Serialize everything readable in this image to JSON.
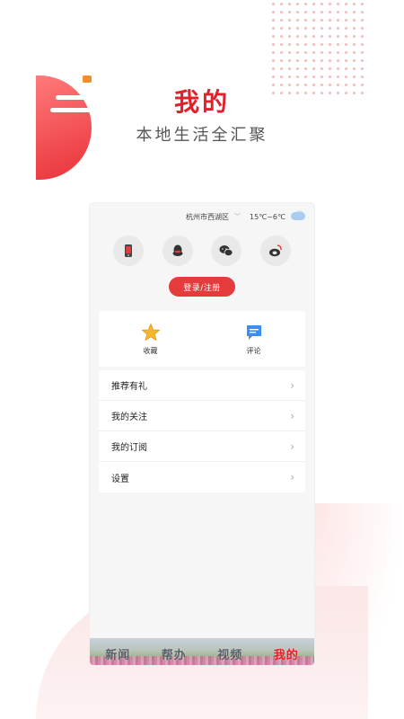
{
  "hero": {
    "title": "我的",
    "subtitle": "本地生活全汇聚"
  },
  "status": {
    "location": "杭州市西湖区",
    "temperature": "15℃~6℃",
    "weather_icon": "cloud-rain-icon"
  },
  "social_logins": [
    {
      "name": "phone-login-icon"
    },
    {
      "name": "qq-login-icon"
    },
    {
      "name": "wechat-login-icon"
    },
    {
      "name": "weibo-login-icon"
    }
  ],
  "login_button": "登录/注册",
  "quick_actions": [
    {
      "label": "收藏",
      "icon": "star-icon"
    },
    {
      "label": "评论",
      "icon": "comment-icon"
    }
  ],
  "menu": [
    {
      "label": "推荐有礼"
    },
    {
      "label": "我的关注"
    },
    {
      "label": "我的订阅"
    },
    {
      "label": "设置"
    }
  ],
  "tabs": [
    {
      "label": "新闻"
    },
    {
      "label": "帮办"
    },
    {
      "label": "视频"
    },
    {
      "label": "我的",
      "active": true
    }
  ],
  "colors": {
    "accent": "#e0202a",
    "login_button": "#e43c3c"
  }
}
